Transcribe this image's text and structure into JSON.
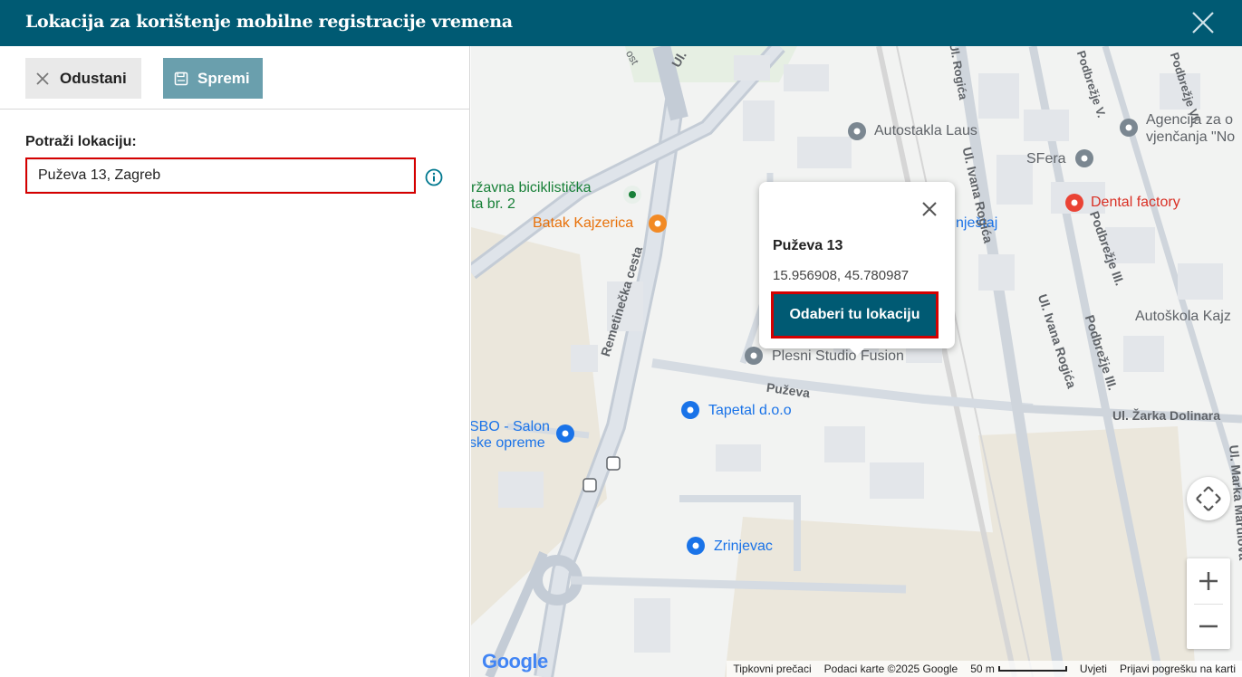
{
  "dialog": {
    "title": "Lokacija za korištenje mobilne registracije vremena"
  },
  "toolbar": {
    "cancel_label": "Odustani",
    "save_label": "Spremi"
  },
  "search": {
    "label": "Potraži lokaciju:",
    "value": "Puževa 13, Zagreb"
  },
  "popup": {
    "title": "Puževa 13",
    "coords": "15.956908, 45.780987",
    "select_label": "Odaberi tu lokaciju"
  },
  "map": {
    "pois": [
      {
        "label": "Autostakla Laus",
        "kind": "grey"
      },
      {
        "label": "Agencija za o",
        "kind": "grey"
      },
      {
        "label": "vjenčanja \"No",
        "kind": "grey"
      },
      {
        "label": "SFera",
        "kind": "grey"
      },
      {
        "label": "Dental factory",
        "kind": "red"
      },
      {
        "label": "ržavna biciklistička",
        "kind": "green"
      },
      {
        "label": "ta br. 2",
        "kind": "green"
      },
      {
        "label": "Batak Kajzerica",
        "kind": "orange"
      },
      {
        "label": "nještaj",
        "kind": "blue"
      },
      {
        "label": "Plesni Studio Fusion",
        "kind": "grey"
      },
      {
        "label": "Tapetal d.o.o",
        "kind": "blue"
      },
      {
        "label": "SBO - Salon",
        "kind": "blue"
      },
      {
        "label": "ske opreme",
        "kind": "blue"
      },
      {
        "label": "Zrinjevac",
        "kind": "blue"
      },
      {
        "label": "Autoškola Kajz",
        "kind": "grey"
      }
    ],
    "streets": [
      "Remetinečka cesta",
      "Puževa",
      "Ul. Ivana Rogića",
      "Ul. Ivana Rogića",
      "Podbrežje III.",
      "Podbrežje III.",
      "Ul. Žarka Dolinara",
      "Ul. Marka Marulova",
      "Ul.",
      "Podbrežje V.",
      "Podbrežje VI.",
      "Ul. Rogića",
      "ost"
    ],
    "attribution": {
      "shortcuts": "Tipkovni prečaci",
      "data": "Podaci karte ©2025 Google",
      "scale": "50 m",
      "terms": "Uvjeti",
      "report": "Prijavi pogrešku na karti"
    },
    "logo": "Google"
  }
}
